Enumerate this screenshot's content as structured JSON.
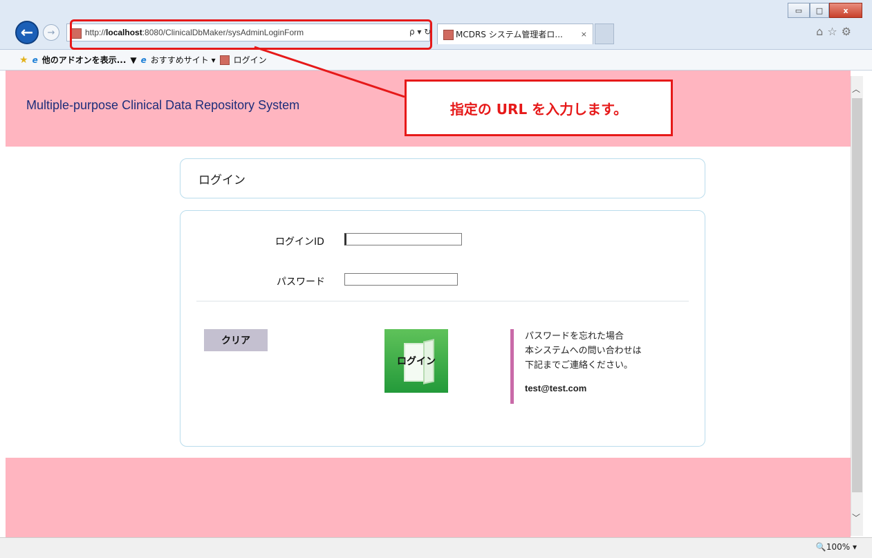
{
  "browser": {
    "window_controls": {
      "minimize": "▭",
      "maximize": "□",
      "close": "x"
    },
    "address": {
      "prefix": "http://",
      "host": "localhost",
      "rest": ":8080/ClinicalDbMaker/sysAdminLoginForm"
    },
    "address_tools": "ρ ▾ ↻",
    "tab": {
      "title": "MCDRS システム管理者ロ...",
      "close": "×"
    },
    "toolbar_icons": "⌂☆⚙",
    "favorites": [
      {
        "label": "他のアドオンを表示...",
        "icon": "ie-icon",
        "bold": true
      },
      {
        "label": "おすすめサイト ▾",
        "icon": "ie-icon"
      },
      {
        "label": "ログイン",
        "icon": "page-icon"
      }
    ],
    "favorites_dropdown": "▼",
    "zoom": "🔍100%  ▾"
  },
  "page": {
    "site_title": "Multiple-purpose Clinical Data Repository System",
    "panel_title": "ログイン",
    "form": {
      "login_id_label": "ログインID",
      "login_id_value": "",
      "password_label": "パスワード",
      "password_value": ""
    },
    "buttons": {
      "clear": "クリア",
      "login": "ログイン"
    },
    "help": {
      "lines": [
        "パスワードを忘れた場合",
        "本システムへの問い合わせは",
        "下記までご連絡ください。"
      ],
      "email": "test@test.com"
    }
  },
  "annotation": {
    "callout": "指定の URL を入力します。",
    "color": "#e61919"
  },
  "colors": {
    "header_bg": "#ffb5c0",
    "title_text": "#1c2d7a",
    "login_green": "#239a3a",
    "help_bar": "#c96aa8"
  }
}
